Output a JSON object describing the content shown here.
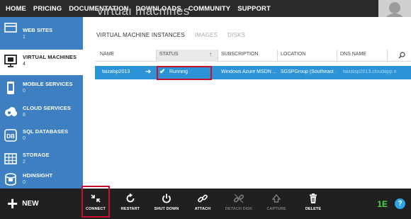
{
  "topnav": {
    "items": [
      "HOME",
      "PRICING",
      "DOCUMENTATION",
      "DOWNLOADS",
      "COMMUNITY",
      "SUPPORT"
    ]
  },
  "page": {
    "title_partial": "virtual machines"
  },
  "sidebar": {
    "items": [
      {
        "label": "WEB SITES",
        "count": "1",
        "icon": "web-sites-icon"
      },
      {
        "label": "VIRTUAL MACHINES",
        "count": "4",
        "icon": "virtual-machines-icon"
      },
      {
        "label": "MOBILE SERVICES",
        "count": "0",
        "icon": "mobile-services-icon"
      },
      {
        "label": "CLOUD SERVICES",
        "count": "8",
        "icon": "cloud-services-icon"
      },
      {
        "label": "SQL DATABASES",
        "count": "0",
        "icon": "sql-databases-icon"
      },
      {
        "label": "STORAGE",
        "count": "2",
        "icon": "storage-icon"
      },
      {
        "label": "HDINSIGHT",
        "count": "0",
        "icon": "hdinsight-icon"
      }
    ]
  },
  "tabs": [
    "VIRTUAL MACHINE INSTANCES",
    "IMAGES",
    "DISKS"
  ],
  "table": {
    "columns": [
      "NAME",
      "STATUS",
      "SUBSCRIPTION",
      "LOCATION",
      "DNS NAME"
    ],
    "sort_indicator": "↑",
    "rows": [
      {
        "name": "faizalsp2013",
        "status": "Running",
        "subscription": "Windows Azure MSDN ...",
        "location": "SGSPGroup (Southeast ...",
        "dns": "faizalsp2013.cloudapp.n"
      }
    ]
  },
  "commandbar": {
    "new_label": "NEW",
    "commands": [
      {
        "label": "CONNECT",
        "icon": "connect-icon",
        "enabled": true
      },
      {
        "label": "RESTART",
        "icon": "restart-icon",
        "enabled": true
      },
      {
        "label": "SHUT DOWN",
        "icon": "power-icon",
        "enabled": true
      },
      {
        "label": "ATTACH",
        "icon": "attach-icon",
        "enabled": true
      },
      {
        "label": "DETACH DISK",
        "icon": "detach-disk-icon",
        "enabled": false
      },
      {
        "label": "CAPTURE",
        "icon": "capture-icon",
        "enabled": false
      },
      {
        "label": "DELETE",
        "icon": "trash-icon",
        "enabled": true
      }
    ],
    "activity_label": "1E",
    "help_label": "?"
  },
  "colors": {
    "nav_bg": "#2b2b2b",
    "sidebar_bg": "#3d7fc1",
    "row_selected": "#2b93d6",
    "cmdbar_bg": "#202020",
    "highlight_box": "#c8102e"
  }
}
